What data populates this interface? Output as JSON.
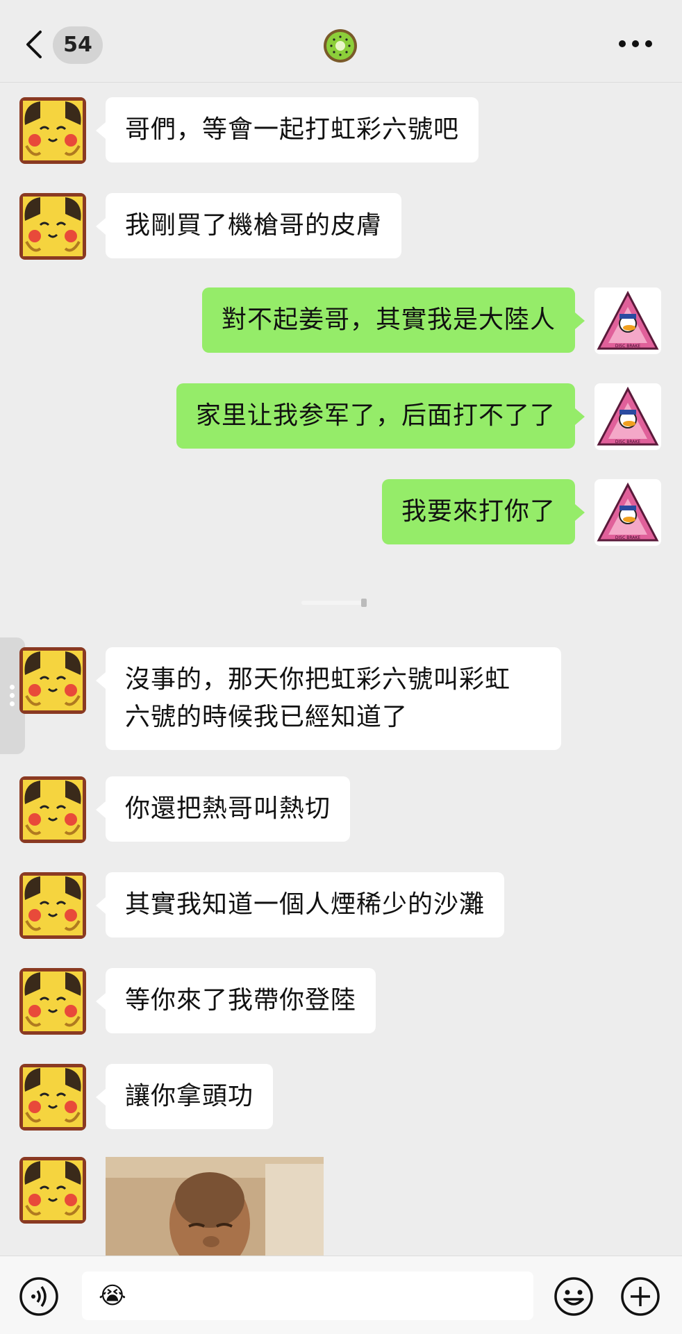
{
  "header": {
    "unread_count": "54",
    "title_icon": "kiwi-icon",
    "back_icon": "chevron-left-icon",
    "more_icon": "more-dots-icon"
  },
  "messages": [
    {
      "side": "left",
      "text": "哥們，等會一起打虹彩六號吧"
    },
    {
      "side": "left",
      "text": "我剛買了機槍哥的皮膚"
    },
    {
      "side": "right",
      "text": "對不起姜哥，其實我是大陸人"
    },
    {
      "side": "right",
      "text": "家里让我参军了，后面打不了了"
    },
    {
      "side": "right",
      "text": "我要來打你了"
    },
    {
      "side": "left",
      "line1": "沒事的，那天你把虹彩六號叫彩虹",
      "line2": "六號的時候我已經知道了"
    },
    {
      "side": "left",
      "text": "你還把熱哥叫熱切"
    },
    {
      "side": "left",
      "text": "其實我知道一個人煙稀少的沙灘"
    },
    {
      "side": "left",
      "text": "等你來了我帶你登陸"
    },
    {
      "side": "left",
      "text": "讓你拿頭功"
    },
    {
      "side": "left",
      "type": "image",
      "description_icon": "photo-message"
    }
  ],
  "right_avatar": {
    "caption": "DISC BRAKE"
  },
  "input": {
    "value": "😭",
    "voice_icon": "voice-icon",
    "emoji_icon": "emoji-icon",
    "plus_icon": "plus-icon"
  },
  "colors": {
    "background": "#ededed",
    "bubble_left": "#ffffff",
    "bubble_right": "#95ec69",
    "avatar_pikachu": "#f5d43f",
    "avatar_triangle": "#e0609a"
  }
}
